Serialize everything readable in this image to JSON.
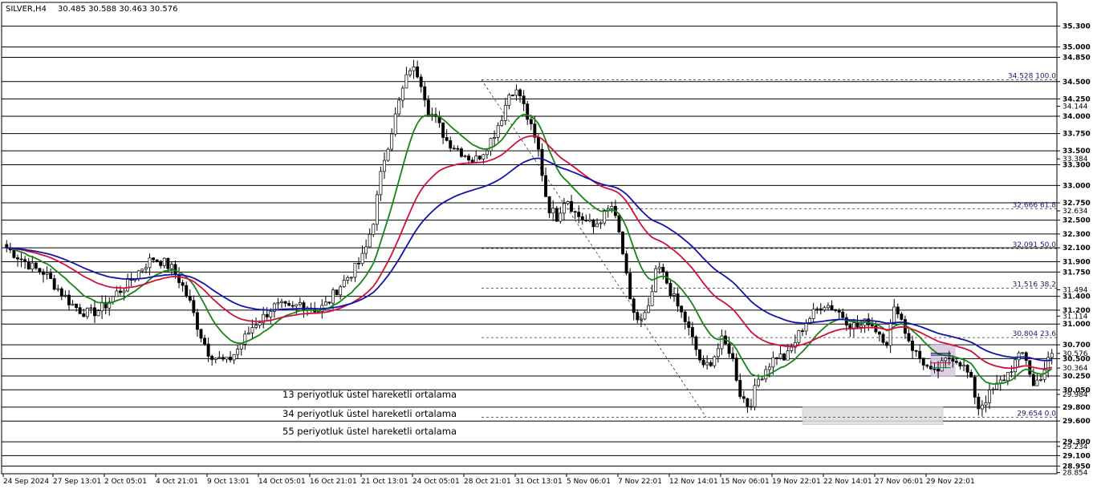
{
  "header": {
    "symbol": "SILVER,H4",
    "ohlc": "30.485 30.588 30.463 30.576"
  },
  "legend": [
    {
      "label": "13 periyotluk üstel hareketli ortalama",
      "color": "#15851a"
    },
    {
      "label": "34 periyotluk üstel hareketli ortalama",
      "color": "#d0103a"
    },
    {
      "label": "55 periyotluk üstel hareketli ortalama",
      "color": "#1414a8"
    }
  ],
  "chart_data": {
    "type": "candlestick",
    "ylim": [
      28.85,
      35.4
    ],
    "x_tick_labels": [
      "24 Sep 2024",
      "27 Sep 13:01",
      "2 Oct 05:01",
      "4 Oct 21:01",
      "9 Oct 13:01",
      "14 Oct 05:01",
      "16 Oct 21:01",
      "21 Oct 13:01",
      "24 Oct 05:01",
      "28 Oct 21:01",
      "31 Oct 13:01",
      "5 Nov 06:01",
      "7 Nov 22:01",
      "12 Nov 14:01",
      "15 Nov 06:01",
      "19 Nov 22:01",
      "22 Nov 14:01",
      "27 Nov 06:01",
      "29 Nov 22:01"
    ],
    "y_tick_labels": [
      "35.300",
      "35.000",
      "34.850",
      "34.500",
      "34.250",
      "34.144",
      "34.000",
      "33.750",
      "33.500",
      "33.384",
      "33.300",
      "33.000",
      "32.750",
      "32.634",
      "32.500",
      "32.300",
      "32.100",
      "31.900",
      "31.750",
      "31.494",
      "31.400",
      "31.200",
      "31.114",
      "31.000",
      "30.700",
      "30.576",
      "30.500",
      "30.364",
      "30.250",
      "30.050",
      "29.984",
      "29.800",
      "29.600",
      "29.234",
      "29.300",
      "29.100",
      "28.950",
      "28.854"
    ],
    "horizontal_levels": [
      35.3,
      35.0,
      34.85,
      34.5,
      34.25,
      34.0,
      33.75,
      33.5,
      33.3,
      33.0,
      32.75,
      32.5,
      32.3,
      32.1,
      31.9,
      31.75,
      31.4,
      31.2,
      31.0,
      30.7,
      30.5,
      30.25,
      30.05,
      29.8,
      29.6,
      29.3,
      29.1,
      28.95
    ],
    "fibonacci": [
      {
        "label": "34.528 100.0",
        "price": 34.528
      },
      {
        "label": "32.666 61.8",
        "price": 32.666
      },
      {
        "label": "32.091 50.0",
        "price": 32.091
      },
      {
        "label": "31.516 38.2",
        "price": 31.516
      },
      {
        "label": "30.804 23.6",
        "price": 30.804
      },
      {
        "label": "29.654 0.0",
        "price": 29.654
      }
    ],
    "close_path": [
      32.1,
      32.0,
      31.9,
      31.8,
      31.75,
      31.6,
      31.45,
      31.3,
      31.2,
      31.15,
      31.2,
      31.3,
      31.45,
      31.55,
      31.7,
      31.85,
      31.95,
      31.9,
      31.8,
      31.6,
      31.3,
      30.9,
      30.6,
      30.5,
      30.45,
      30.6,
      30.8,
      31.0,
      31.1,
      31.25,
      31.25,
      31.2,
      31.3,
      31.25,
      31.2,
      31.3,
      31.5,
      31.65,
      31.8,
      32.0,
      32.5,
      33.3,
      33.8,
      34.3,
      34.7,
      34.6,
      34.1,
      33.9,
      33.65,
      33.55,
      33.45,
      33.35,
      33.5,
      33.7,
      34.0,
      34.4,
      34.3,
      33.9,
      33.5,
      32.7,
      32.55,
      32.85,
      32.6,
      32.5,
      32.4,
      32.55,
      32.7,
      32.2,
      31.3,
      31.0,
      31.2,
      31.85,
      31.6,
      31.3,
      31.05,
      30.7,
      30.35,
      30.5,
      30.75,
      30.6,
      30.0,
      29.8,
      30.2,
      30.4,
      30.55,
      30.5,
      30.75,
      31.0,
      31.15,
      31.3,
      31.25,
      31.15,
      31.0,
      30.95,
      31.05,
      30.9,
      30.75,
      31.3,
      30.9,
      30.6,
      30.45,
      30.25,
      30.4,
      30.55,
      30.45,
      30.25,
      29.8,
      29.95,
      30.1,
      30.25,
      30.45,
      30.6,
      30.1,
      30.3,
      30.576
    ],
    "series": [
      {
        "name": "13 periyotluk üstel hareketli ortalama",
        "period": 13
      },
      {
        "name": "34 periyotluk üstel hareketli ortalama",
        "period": 34
      },
      {
        "name": "55 periyotluk üstel hareketli ortalama",
        "period": 55
      }
    ],
    "zones": [
      {
        "from": 30.25,
        "to": 30.7,
        "color": "#d6c8e2"
      },
      {
        "from": 29.55,
        "to": 29.8,
        "color": "#dcdcdc"
      }
    ],
    "right_marks": [
      {
        "price": 30.576,
        "label": "30.576",
        "color": "#000000"
      },
      {
        "price": 30.55,
        "label": "",
        "color": "#1414a8"
      },
      {
        "price": 30.44,
        "label": "",
        "color": "#d0103a"
      },
      {
        "price": 30.37,
        "label": "",
        "color": "#15851a"
      }
    ]
  }
}
